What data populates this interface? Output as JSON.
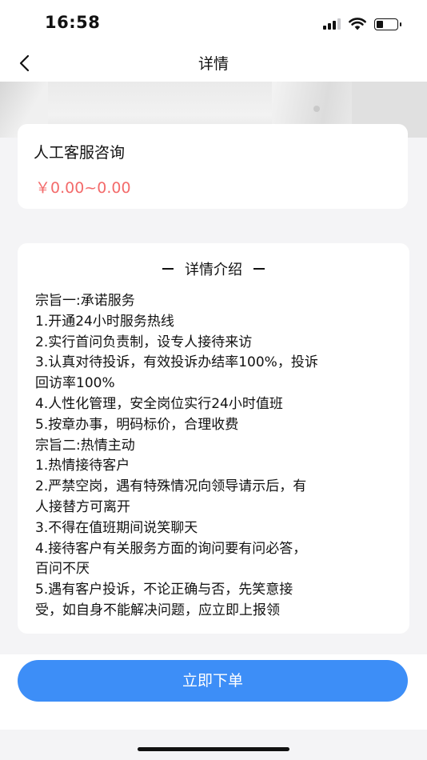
{
  "status_bar": {
    "time": "16:58"
  },
  "nav": {
    "title": "详情",
    "back_icon": "chevron-left-icon"
  },
  "product": {
    "title": "人工客服咨询",
    "price": "￥0.00~0.00",
    "price_color": "#f36b6b"
  },
  "detail": {
    "heading": "详情介绍",
    "lines": [
      "宗旨一:承诺服务",
      "1.开通24小时服务热线",
      "2.实行首问负责制，设专人接待来访",
      "3.认真对待投诉，有效投诉办结率100%，投诉",
      "回访率100%",
      "4.人性化管理，安全岗位实行24小时值班",
      "5.按章办事，明码标价，合理收费",
      "宗旨二:热情主动",
      "1.热情接待客户",
      "2.严禁空岗，遇有特殊情况向领导请示后，有",
      "人接替方可离开",
      "3.不得在值班期间说笑聊天",
      "4.接待客户有关服务方面的询问要有问必答，",
      "百问不厌",
      "5.遇有客户投诉，不论正确与否，先笑意接",
      "受，如自身不能解决问题，应立即上报领"
    ]
  },
  "action": {
    "order_label": "立即下单",
    "button_color": "#3d8ef7"
  }
}
